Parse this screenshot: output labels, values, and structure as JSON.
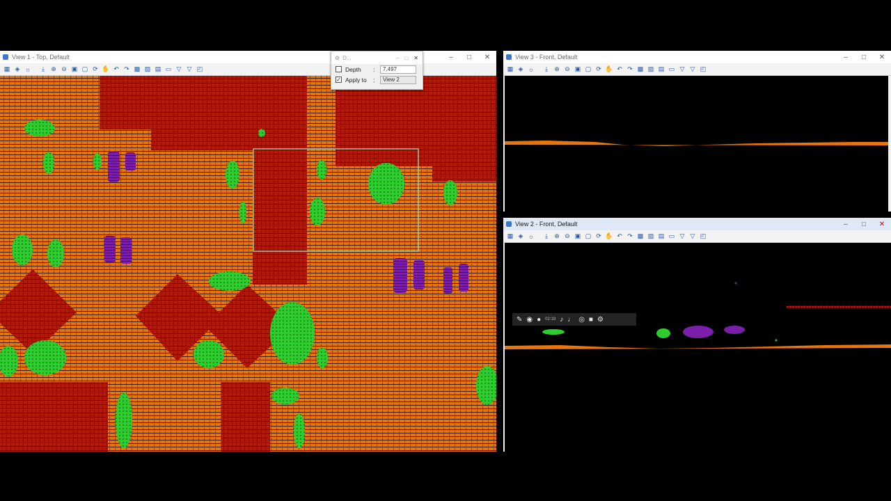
{
  "views": {
    "view1": {
      "title": "View 1 - Top, Default"
    },
    "view3": {
      "title": "View 3 - Front, Default"
    },
    "view2": {
      "title": "View 2 - Front, Default"
    }
  },
  "dialog": {
    "title": "D...",
    "depth_label": "Depth",
    "depth_value": "7.497",
    "apply_label": "Apply to",
    "apply_value": "View 2",
    "depth_checked": false,
    "apply_checked": true
  },
  "recorder": {
    "time": "02:18"
  },
  "colors": {
    "ground": "#e8760f",
    "building": "#b01a0a",
    "vegetation": "#2ecc2e",
    "vehicle": "#7a1fa8",
    "background": "#000000"
  },
  "icons": {
    "app": "microstation-view-icon",
    "toolbar": [
      "view-attributes-icon",
      "display-style-icon",
      "brightness-icon",
      "update-icon",
      "zoom-in-icon",
      "zoom-out-icon",
      "fit-view-icon",
      "window-area-icon",
      "rotate-icon",
      "pan-icon",
      "view-previous-icon",
      "view-next-icon",
      "clip-volume-icon",
      "clip-mask-icon",
      "levels-icon",
      "fence-icon"
    ]
  }
}
